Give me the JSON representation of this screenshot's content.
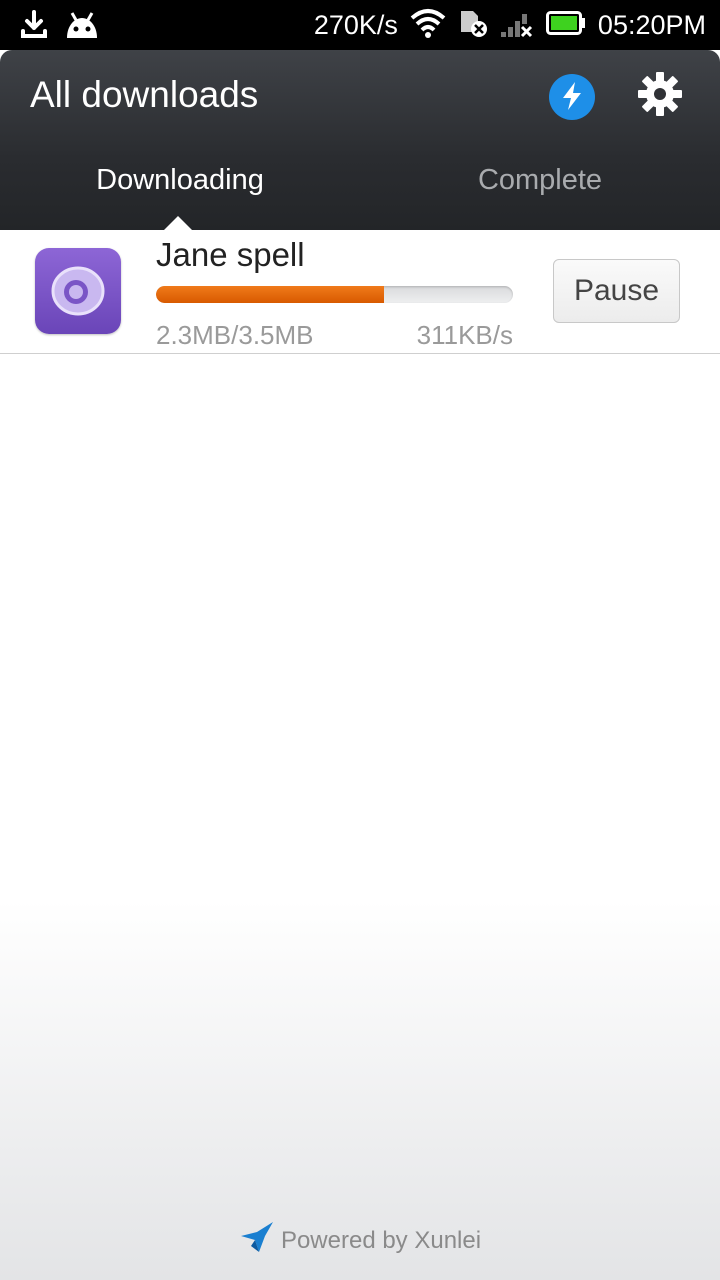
{
  "status_bar": {
    "net_speed": "270K/s",
    "time": "05:20PM",
    "icons": [
      "download-icon",
      "android-icon",
      "wifi-icon",
      "sim-error-icon",
      "signal-no-service-icon",
      "battery-charging-icon"
    ]
  },
  "header": {
    "title": "All downloads",
    "tabs": [
      {
        "label": "Downloading",
        "active": true
      },
      {
        "label": "Complete",
        "active": false
      }
    ]
  },
  "downloads": [
    {
      "name": "Jane spell",
      "progress": 0.64,
      "size": "2.3MB/3.5MB",
      "speed": "311KB/s",
      "action": "Pause"
    }
  ],
  "footer": {
    "powered_by": "Powered by Xunlei"
  },
  "colors": {
    "accent_blue": "#1e8fe8",
    "progress_orange": "#e2650a",
    "header_dark": "#2a2c30",
    "app_icon_purple": "#7a55c6"
  }
}
